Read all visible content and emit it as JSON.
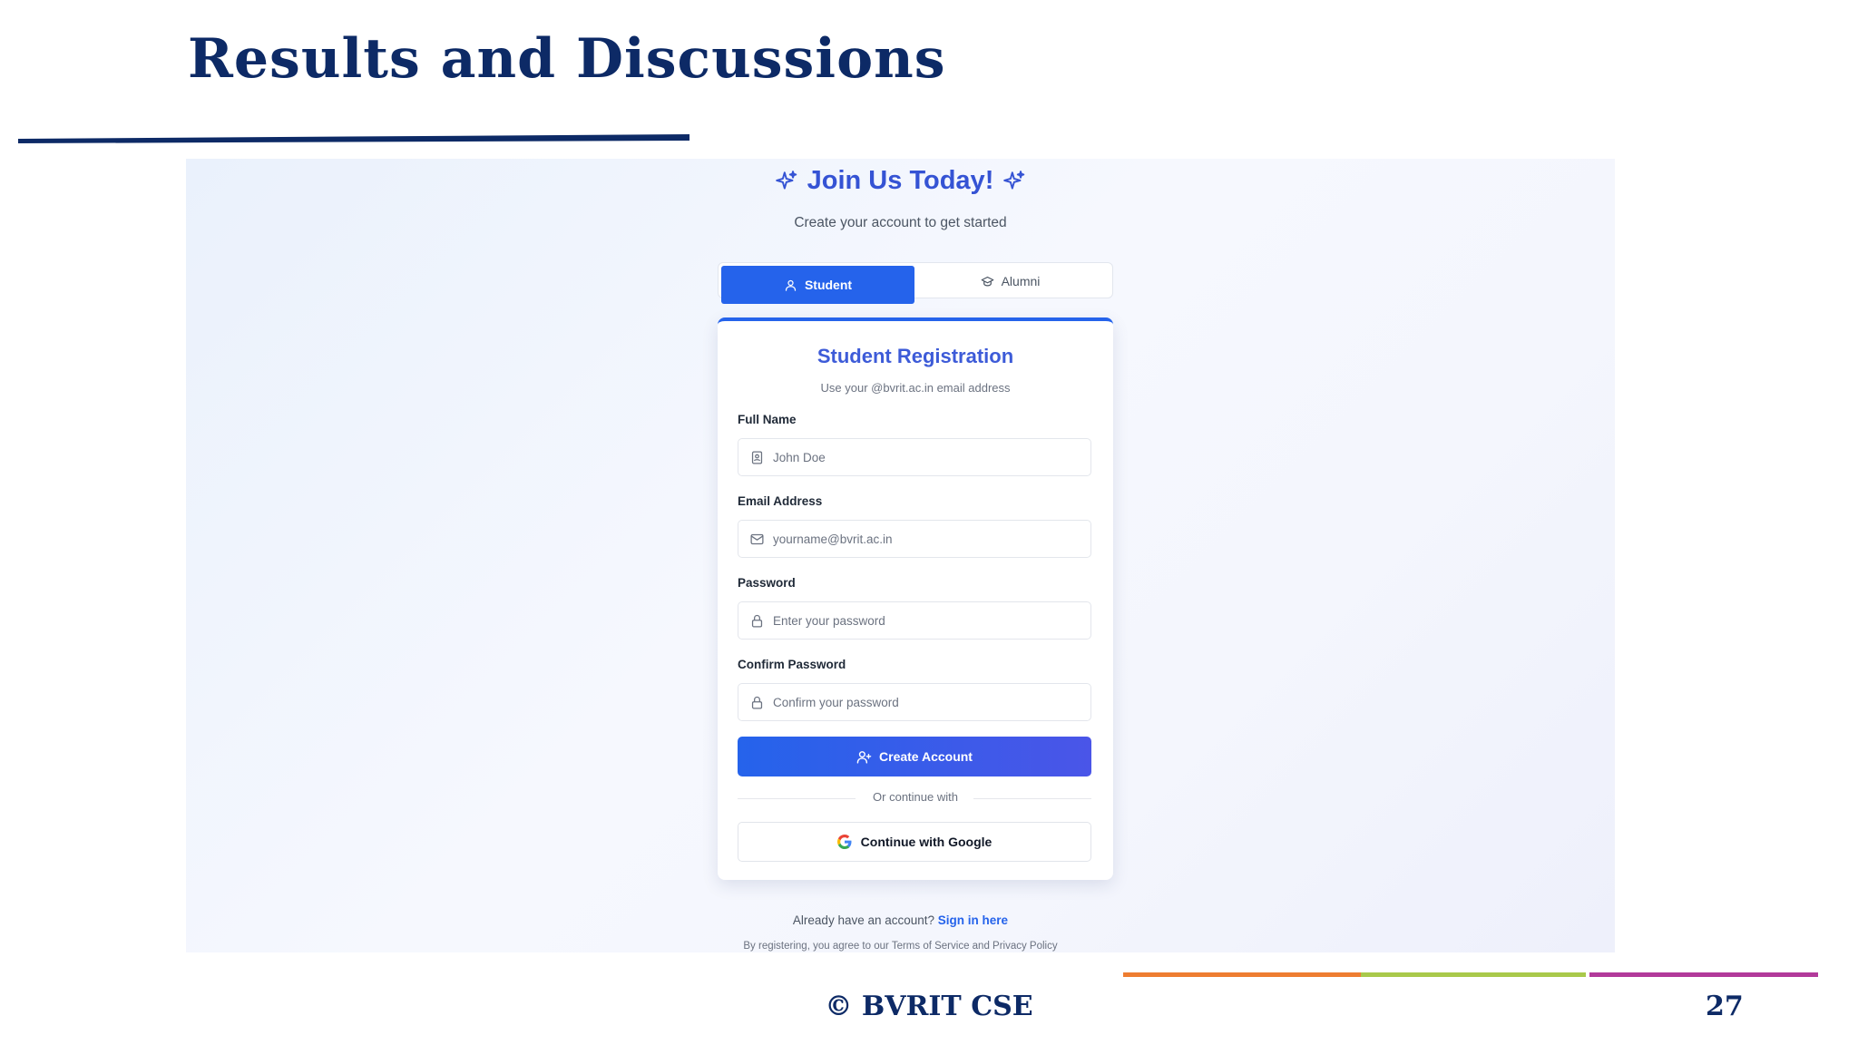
{
  "slide": {
    "title": "Results and Discussions",
    "footer": "© BVRIT CSE",
    "page_number": "27"
  },
  "signup": {
    "heading": "Join Us Today!",
    "subheading": "Create your account to get started",
    "tabs": [
      {
        "label": "Student",
        "icon": "user-icon",
        "selected": true
      },
      {
        "label": "Alumni",
        "icon": "graduation-cap-icon",
        "selected": false
      }
    ],
    "form": {
      "title": "Student Registration",
      "subtitle": "Use your @bvrit.ac.in email address",
      "fields": [
        {
          "label": "Full Name",
          "placeholder": "John Doe",
          "icon": "id-card-icon"
        },
        {
          "label": "Email Address",
          "placeholder": "yourname@bvrit.ac.in",
          "icon": "mail-icon"
        },
        {
          "label": "Password",
          "placeholder": "Enter your password",
          "icon": "lock-icon"
        },
        {
          "label": "Confirm Password",
          "placeholder": "Confirm your password",
          "icon": "lock-icon"
        }
      ],
      "submit_label": "Create Account",
      "divider_text": "Or continue with",
      "google_label": "Continue with Google"
    },
    "signin_prompt": "Already have an account?",
    "signin_link": "Sign in here",
    "terms": "By registering, you agree to our Terms of Service and Privacy Policy"
  },
  "colors": {
    "title_navy": "#0d2a66",
    "primary_blue": "#2563eb",
    "footer_bar": [
      "#ee7d31",
      "#a9c94b",
      "#b23a9a"
    ]
  }
}
